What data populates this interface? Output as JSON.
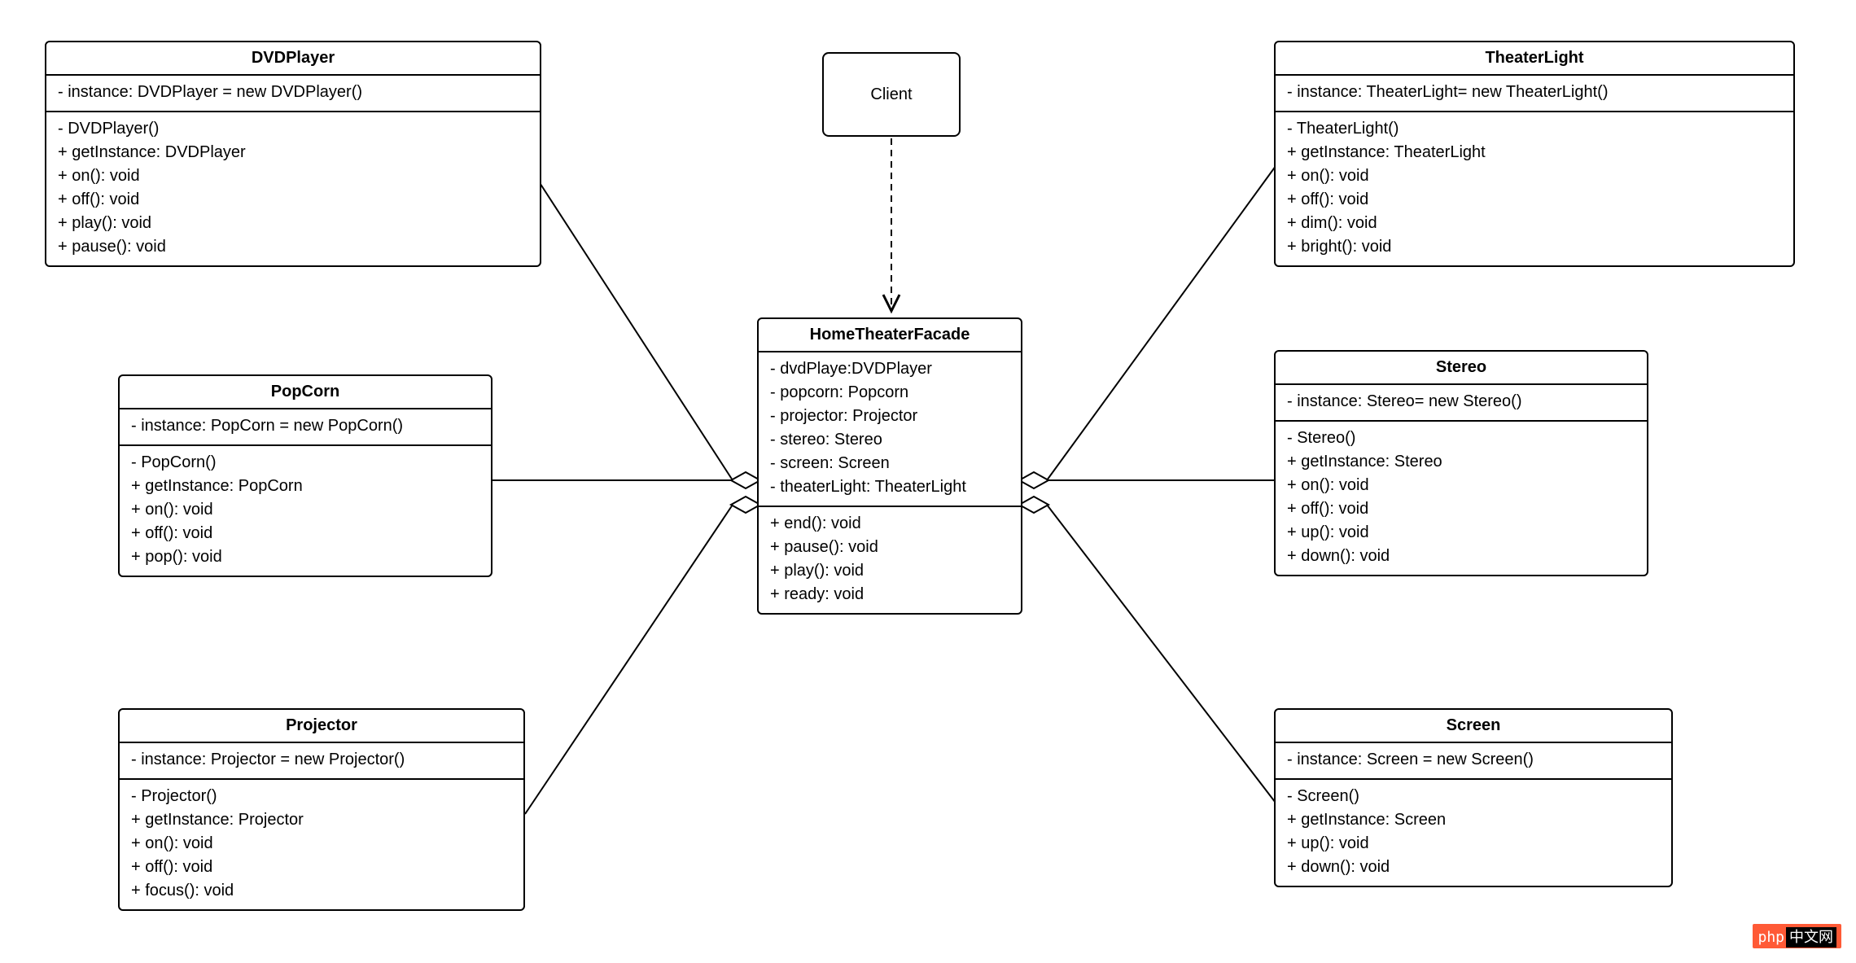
{
  "client": {
    "label": "Client"
  },
  "facade": {
    "name": "HomeTheaterFacade",
    "attrs": [
      "- dvdPlaye:DVDPlayer",
      "- popcorn: Popcorn",
      "- projector: Projector",
      "- stereo: Stereo",
      "- screen: Screen",
      "- theaterLight: TheaterLight"
    ],
    "methods": [
      "+ end(): void",
      "+ pause(): void",
      "+ play(): void",
      "+ ready: void"
    ]
  },
  "dvdplayer": {
    "name": "DVDPlayer",
    "attrs": [
      "- instance: DVDPlayer = new DVDPlayer()"
    ],
    "methods": [
      "-  DVDPlayer()",
      "+ getInstance: DVDPlayer",
      "+ on(): void",
      "+ off(): void",
      "+ play(): void",
      "+ pause(): void"
    ]
  },
  "popcorn": {
    "name": "PopCorn",
    "attrs": [
      "- instance: PopCorn = new PopCorn()"
    ],
    "methods": [
      "-  PopCorn()",
      "+ getInstance: PopCorn",
      "+ on(): void",
      "+ off(): void",
      "+ pop(): void"
    ]
  },
  "projector": {
    "name": "Projector",
    "attrs": [
      "- instance: Projector = new Projector()"
    ],
    "methods": [
      "-  Projector()",
      "+ getInstance: Projector",
      "+ on(): void",
      "+ off(): void",
      "+ focus(): void"
    ]
  },
  "theaterlight": {
    "name": "TheaterLight",
    "attrs": [
      "- instance: TheaterLight= new TheaterLight()"
    ],
    "methods": [
      "-  TheaterLight()",
      "+ getInstance: TheaterLight",
      "+ on(): void",
      "+ off(): void",
      "+ dim(): void",
      "+ bright(): void"
    ]
  },
  "stereo": {
    "name": "Stereo",
    "attrs": [
      "- instance: Stereo= new Stereo()"
    ],
    "methods": [
      "-  Stereo()",
      "+ getInstance: Stereo",
      "+ on(): void",
      "+ off(): void",
      "+ up(): void",
      "+ down(): void"
    ]
  },
  "screen": {
    "name": "Screen",
    "attrs": [
      "- instance: Screen = new Screen()"
    ],
    "methods": [
      "-  Screen()",
      "+ getInstance: Screen",
      "+ up(): void",
      "+ down(): void"
    ]
  },
  "watermark": {
    "left": "php",
    "right": "中文网"
  }
}
